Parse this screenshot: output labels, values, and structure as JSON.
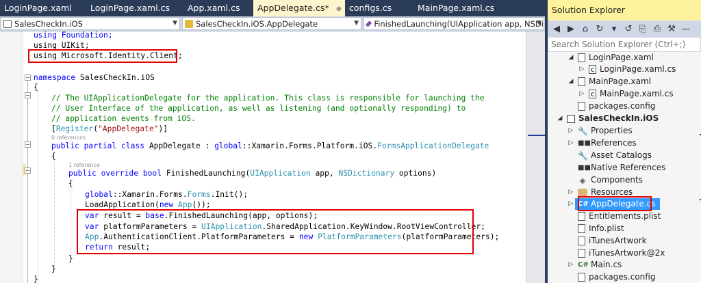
{
  "tabs": [
    {
      "label": "LoginPage.xaml"
    },
    {
      "label": "LoginPage.xaml.cs"
    },
    {
      "label": "App.xaml.cs"
    },
    {
      "label": "AppDelegate.cs*",
      "pin": "⊕",
      "close": "✕"
    },
    {
      "label": "configs.cs"
    },
    {
      "label": "MainPage.xaml.cs"
    }
  ],
  "navbar": {
    "project": "SalesCheckIn.iOS",
    "class": "SalesCheckIn.iOS.AppDelegate",
    "member": "FinishedLaunching(UIApplication app, NSDi"
  },
  "codelens": {
    "class_refs": "0 references",
    "method_refs": "1 reference"
  },
  "code": {
    "l1": "using Foundation;",
    "l2": "using UIKit;",
    "l3": "using Microsoft.Identity.Client;",
    "l4_kw": "namespace",
    "l4_rest": " SalesCheckIn.iOS",
    "l5": "{",
    "l6": "// The UIApplicationDelegate for the application. This class is responsible for launching the",
    "l7": "// User Interface of the application, as well as listening (and optionally responding) to",
    "l8": "// application events from iOS.",
    "l9_a": "[",
    "l9_b": "Register",
    "l9_c": "(",
    "l9_d": "\"AppDelegate\"",
    "l9_e": ")]",
    "l10_a": "public partial class",
    "l10_b": " AppDelegate : ",
    "l10_c": "global",
    "l10_d": "::Xamarin.Forms.Platform.iOS.",
    "l10_e": "FormsApplicationDelegate",
    "l11": "{",
    "l12_a": "public override bool",
    "l12_b": " FinishedLaunching(",
    "l12_c": "UIApplication",
    "l12_d": " app, ",
    "l12_e": "NSDictionary",
    "l12_f": " options)",
    "l13": "{",
    "l14_a": "global",
    "l14_b": "::Xamarin.Forms.",
    "l14_c": "Forms",
    "l14_d": ".Init();",
    "l15_a": "LoadApplication(",
    "l15_b": "new",
    "l15_c": " ",
    "l15_d": "App",
    "l15_e": "());",
    "l16_a": "var",
    "l16_b": " result = ",
    "l16_c": "base",
    "l16_d": ".FinishedLaunching(app, options);",
    "l17_a": "var",
    "l17_b": " platformParameters = ",
    "l17_c": "UIApplication",
    "l17_d": ".SharedApplication.KeyWindow.RootViewController;",
    "l18_a": "App",
    "l18_b": ".AuthenticationClient.PlatformParameters = ",
    "l18_c": "new",
    "l18_d": " ",
    "l18_e": "PlatformParameters",
    "l18_f": "(platformParameters);",
    "l19_a": "return",
    "l19_b": " result;",
    "l20": "}",
    "l21": "}",
    "l22": "}"
  },
  "solution_explorer": {
    "title": "Solution Explorer",
    "toolbar": [
      "◀",
      "▶",
      "⌂",
      "↻",
      "▾",
      "↺",
      "⎘",
      "⎙",
      "⚒",
      "—"
    ],
    "search_placeholder": "Search Solution Explorer (Ctrl+;)",
    "items": [
      {
        "label": "LoginPage.xaml",
        "twisty": "◢",
        "icon": "page"
      },
      {
        "label": "LoginPage.xaml.cs",
        "twisty": "▷",
        "icon": "csfile"
      },
      {
        "label": "MainPage.xaml",
        "twisty": "◢",
        "icon": "page"
      },
      {
        "label": "MainPage.xaml.cs",
        "twisty": "▷",
        "icon": "csfile"
      },
      {
        "label": "packages.config",
        "twisty": "",
        "icon": "config"
      },
      {
        "label": "SalesCheckIn.iOS",
        "twisty": "◢",
        "icon": "proj"
      },
      {
        "label": "Properties",
        "twisty": "▷",
        "icon": "wrench"
      },
      {
        "label": "References",
        "twisty": "▷",
        "icon": "refs"
      },
      {
        "label": "Asset Catalogs",
        "twisty": "",
        "icon": "wrench"
      },
      {
        "label": "Native References",
        "twisty": "",
        "icon": "refs"
      },
      {
        "label": "Components",
        "twisty": "",
        "icon": "comp"
      },
      {
        "label": "Resources",
        "twisty": "▷",
        "icon": "folder"
      },
      {
        "label": "AppDelegate.cs",
        "twisty": "▷",
        "icon": "cs",
        "selected": true
      },
      {
        "label": "Entitlements.plist",
        "twisty": "",
        "icon": "page"
      },
      {
        "label": "Info.plist",
        "twisty": "",
        "icon": "page"
      },
      {
        "label": "iTunesArtwork",
        "twisty": "",
        "icon": "page"
      },
      {
        "label": "iTunesArtwork@2x",
        "twisty": "",
        "icon": "page"
      },
      {
        "label": "Main.cs",
        "twisty": "▷",
        "icon": "cs"
      },
      {
        "label": "packages.config",
        "twisty": "",
        "icon": "config"
      }
    ]
  },
  "colors": {
    "highlight_box": "#e00000",
    "selection": "#3399ff",
    "title_bar": "#fff29d"
  }
}
